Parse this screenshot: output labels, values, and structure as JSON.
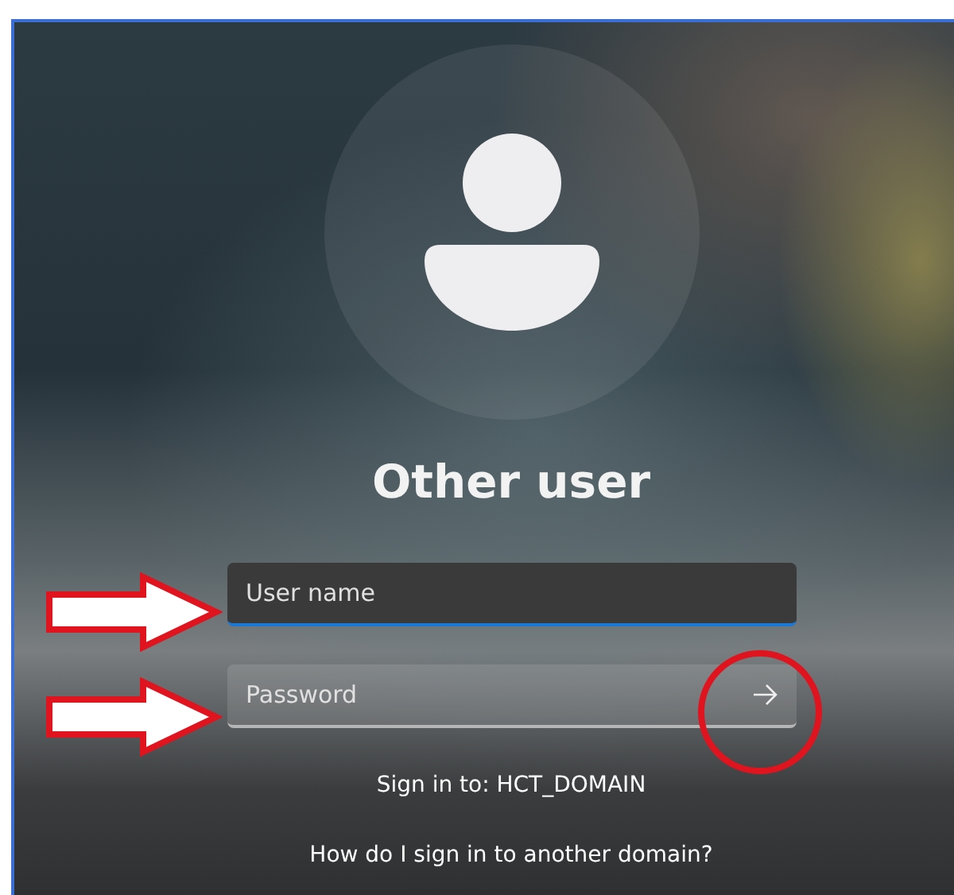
{
  "screen": {
    "title": "Other user",
    "fields": [
      {
        "placeholder": "User name",
        "focused": true,
        "submit_button": false
      },
      {
        "placeholder": "Password",
        "focused": false,
        "submit_button": true
      }
    ],
    "sign_in_to": "Sign in to: HCT_DOMAIN",
    "help_link": "How do I sign in to another domain?"
  },
  "annotations": [
    {
      "kind": "arrow"
    },
    {
      "kind": "arrow"
    },
    {
      "kind": "circle"
    }
  ]
}
